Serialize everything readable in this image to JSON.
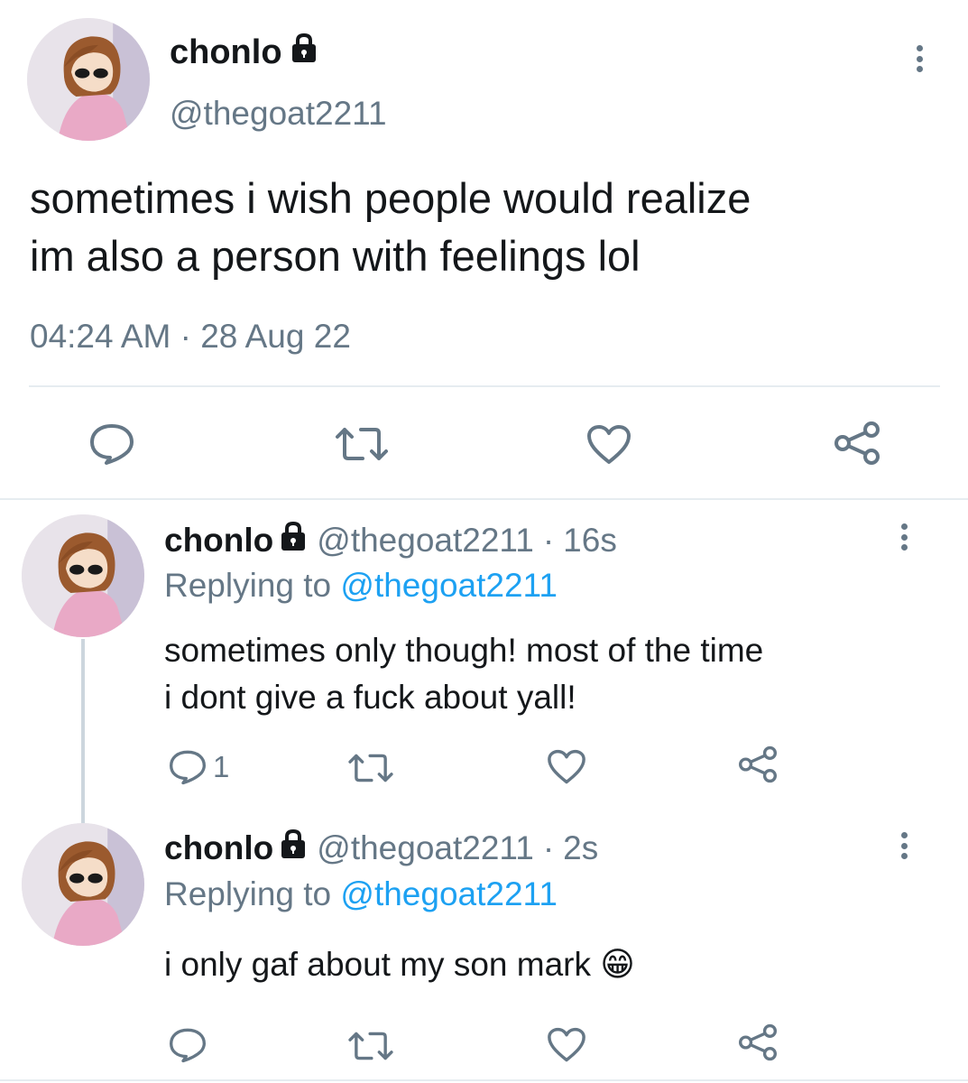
{
  "main_tweet": {
    "display_name": "chonlo",
    "handle": "@thegoat2211",
    "text_line1": "sometimes i wish people would realize",
    "text_line2": "im also a person with feelings lol",
    "time": "04:24 AM",
    "separator": "·",
    "date": "28 Aug 22"
  },
  "replies": [
    {
      "display_name": "chonlo",
      "handle": "@thegoat2211",
      "separator": "·",
      "age": "16s",
      "replying_prefix": "Replying to",
      "replying_to": "@thegoat2211",
      "text_line1": "sometimes only though! most of the time",
      "text_line2": "i dont give a fuck about yall!",
      "reply_count": "1"
    },
    {
      "display_name": "chonlo",
      "handle": "@thegoat2211",
      "separator": "·",
      "age": "2s",
      "replying_prefix": "Replying to",
      "replying_to": "@thegoat2211",
      "text": "i only gaf about my son mark",
      "emoji": "😁"
    }
  ],
  "colors": {
    "text": "#14171a",
    "muted": "#657786",
    "link": "#1da1f2",
    "divider": "#e6ecf0",
    "icon": "#657786"
  },
  "icons": [
    "lock-icon",
    "more-icon",
    "reply-icon",
    "retweet-icon",
    "like-icon",
    "share-icon"
  ]
}
